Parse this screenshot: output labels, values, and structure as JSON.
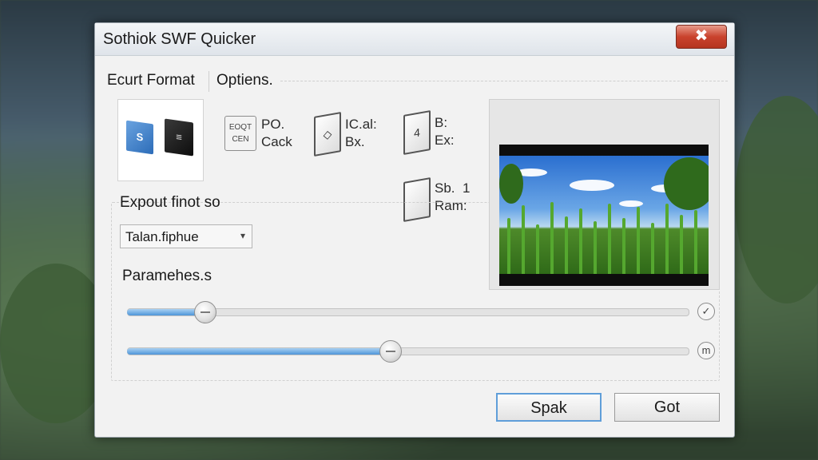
{
  "window": {
    "title": "Sothiok SWF Quicker",
    "close_symbol": "✖"
  },
  "tabs": [
    {
      "label": "Ecurt Format"
    },
    {
      "label": "Optiens."
    }
  ],
  "format_tile": {
    "box1_text": "S",
    "box2_text": "≡"
  },
  "formats": [
    {
      "icon": "export-icon",
      "icon_text_1": "EOQT",
      "icon_text_2": "CEN",
      "line1": "PO.",
      "line2": "Cack"
    },
    {
      "icon": "document-icon",
      "icon_glyph": "◇",
      "line1": "IC.al:",
      "line2": "Bx."
    },
    {
      "icon": "document-icon",
      "icon_glyph": "4",
      "line1": "B:",
      "line2": "Ex:"
    },
    {
      "icon": "document-icon",
      "icon_glyph": "",
      "line1": "Sb.  1",
      "line2": "Ram:"
    }
  ],
  "export_section": {
    "label": "Expout finot so",
    "select_value": "Talan.fiphue",
    "select_arrow": "▾"
  },
  "parameters": {
    "label": "Paramehes.s",
    "sliders": [
      {
        "value_fraction": 0.14,
        "end_icon": "check-circle-icon",
        "end_symbol": "✓"
      },
      {
        "value_fraction": 0.47,
        "end_icon": "m-circle-icon",
        "end_symbol": "m"
      }
    ]
  },
  "buttons": {
    "primary": "Spak",
    "secondary": "Got"
  },
  "colors": {
    "accent": "#4e95d8",
    "close": "#c9432d"
  }
}
